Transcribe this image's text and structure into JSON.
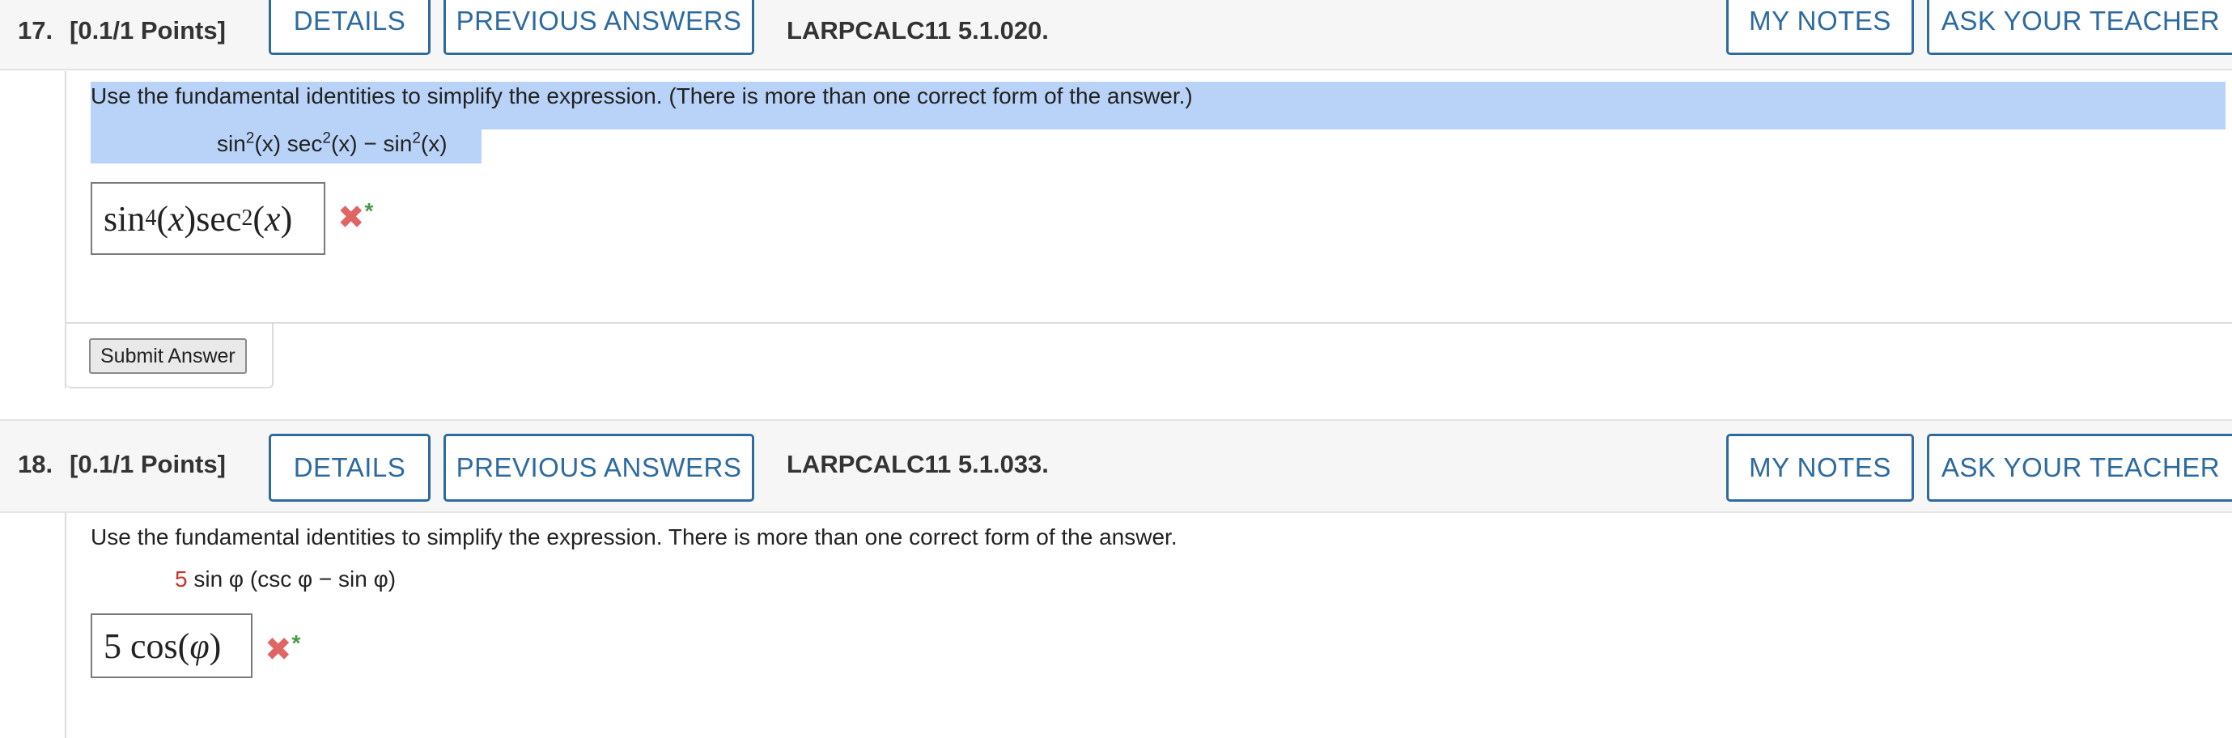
{
  "questions": [
    {
      "number": "17.",
      "points": "[0.1/1 Points]",
      "details_label": "DETAILS",
      "previous_answers_label": "PREVIOUS ANSWERS",
      "code": "LARPCALC11 5.1.020.",
      "my_notes_label": "MY NOTES",
      "ask_teacher_label": "ASK YOUR TEACHER",
      "prompt": "Use the fundamental identities to simplify the expression. (There is more than one correct form of the answer.)",
      "expression": {
        "t1": "sin",
        "e1": "2",
        "t2": "(x) sec",
        "e2": "2",
        "t3": "(x) − sin",
        "e3": "2",
        "t4": "(x)"
      },
      "answer": {
        "f1": "sin",
        "e1": "4",
        "v1": "x",
        "f2": "sec",
        "e2": "2",
        "v2": "x"
      },
      "result_icon": "incorrect-x-icon",
      "submit_label": "Submit Answer"
    },
    {
      "number": "18.",
      "points": "[0.1/1 Points]",
      "details_label": "DETAILS",
      "previous_answers_label": "PREVIOUS ANSWERS",
      "code": "LARPCALC11 5.1.033.",
      "my_notes_label": "MY NOTES",
      "ask_teacher_label": "ASK YOUR TEACHER",
      "prompt": "Use the fundamental identities to simplify the expression. There is more than one correct form of the answer.",
      "expression": {
        "coef": "5",
        "rest": " sin φ (csc φ − sin φ)"
      },
      "answer": {
        "n": "5",
        "f": "cos",
        "v": "φ"
      },
      "result_icon": "incorrect-x-icon"
    }
  ],
  "colors": {
    "button_blue": "#2d6a9f",
    "selection": "#b9d3f8",
    "coefficient_red": "#c8322b",
    "incorrect_red": "#e06666",
    "star_green": "#4a9a4a",
    "header_bg": "#f6f6f6"
  }
}
